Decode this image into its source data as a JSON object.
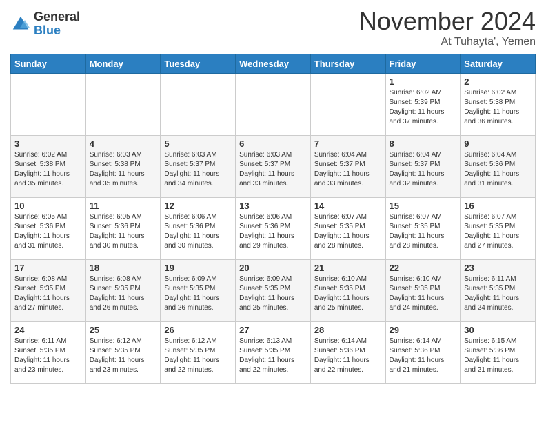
{
  "header": {
    "logo_general": "General",
    "logo_blue": "Blue",
    "month_title": "November 2024",
    "location": "At Tuhayta', Yemen"
  },
  "weekdays": [
    "Sunday",
    "Monday",
    "Tuesday",
    "Wednesday",
    "Thursday",
    "Friday",
    "Saturday"
  ],
  "weeks": [
    [
      {
        "day": "",
        "info": ""
      },
      {
        "day": "",
        "info": ""
      },
      {
        "day": "",
        "info": ""
      },
      {
        "day": "",
        "info": ""
      },
      {
        "day": "",
        "info": ""
      },
      {
        "day": "1",
        "info": "Sunrise: 6:02 AM\nSunset: 5:39 PM\nDaylight: 11 hours\nand 37 minutes."
      },
      {
        "day": "2",
        "info": "Sunrise: 6:02 AM\nSunset: 5:38 PM\nDaylight: 11 hours\nand 36 minutes."
      }
    ],
    [
      {
        "day": "3",
        "info": "Sunrise: 6:02 AM\nSunset: 5:38 PM\nDaylight: 11 hours\nand 35 minutes."
      },
      {
        "day": "4",
        "info": "Sunrise: 6:03 AM\nSunset: 5:38 PM\nDaylight: 11 hours\nand 35 minutes."
      },
      {
        "day": "5",
        "info": "Sunrise: 6:03 AM\nSunset: 5:37 PM\nDaylight: 11 hours\nand 34 minutes."
      },
      {
        "day": "6",
        "info": "Sunrise: 6:03 AM\nSunset: 5:37 PM\nDaylight: 11 hours\nand 33 minutes."
      },
      {
        "day": "7",
        "info": "Sunrise: 6:04 AM\nSunset: 5:37 PM\nDaylight: 11 hours\nand 33 minutes."
      },
      {
        "day": "8",
        "info": "Sunrise: 6:04 AM\nSunset: 5:37 PM\nDaylight: 11 hours\nand 32 minutes."
      },
      {
        "day": "9",
        "info": "Sunrise: 6:04 AM\nSunset: 5:36 PM\nDaylight: 11 hours\nand 31 minutes."
      }
    ],
    [
      {
        "day": "10",
        "info": "Sunrise: 6:05 AM\nSunset: 5:36 PM\nDaylight: 11 hours\nand 31 minutes."
      },
      {
        "day": "11",
        "info": "Sunrise: 6:05 AM\nSunset: 5:36 PM\nDaylight: 11 hours\nand 30 minutes."
      },
      {
        "day": "12",
        "info": "Sunrise: 6:06 AM\nSunset: 5:36 PM\nDaylight: 11 hours\nand 30 minutes."
      },
      {
        "day": "13",
        "info": "Sunrise: 6:06 AM\nSunset: 5:36 PM\nDaylight: 11 hours\nand 29 minutes."
      },
      {
        "day": "14",
        "info": "Sunrise: 6:07 AM\nSunset: 5:35 PM\nDaylight: 11 hours\nand 28 minutes."
      },
      {
        "day": "15",
        "info": "Sunrise: 6:07 AM\nSunset: 5:35 PM\nDaylight: 11 hours\nand 28 minutes."
      },
      {
        "day": "16",
        "info": "Sunrise: 6:07 AM\nSunset: 5:35 PM\nDaylight: 11 hours\nand 27 minutes."
      }
    ],
    [
      {
        "day": "17",
        "info": "Sunrise: 6:08 AM\nSunset: 5:35 PM\nDaylight: 11 hours\nand 27 minutes."
      },
      {
        "day": "18",
        "info": "Sunrise: 6:08 AM\nSunset: 5:35 PM\nDaylight: 11 hours\nand 26 minutes."
      },
      {
        "day": "19",
        "info": "Sunrise: 6:09 AM\nSunset: 5:35 PM\nDaylight: 11 hours\nand 26 minutes."
      },
      {
        "day": "20",
        "info": "Sunrise: 6:09 AM\nSunset: 5:35 PM\nDaylight: 11 hours\nand 25 minutes."
      },
      {
        "day": "21",
        "info": "Sunrise: 6:10 AM\nSunset: 5:35 PM\nDaylight: 11 hours\nand 25 minutes."
      },
      {
        "day": "22",
        "info": "Sunrise: 6:10 AM\nSunset: 5:35 PM\nDaylight: 11 hours\nand 24 minutes."
      },
      {
        "day": "23",
        "info": "Sunrise: 6:11 AM\nSunset: 5:35 PM\nDaylight: 11 hours\nand 24 minutes."
      }
    ],
    [
      {
        "day": "24",
        "info": "Sunrise: 6:11 AM\nSunset: 5:35 PM\nDaylight: 11 hours\nand 23 minutes."
      },
      {
        "day": "25",
        "info": "Sunrise: 6:12 AM\nSunset: 5:35 PM\nDaylight: 11 hours\nand 23 minutes."
      },
      {
        "day": "26",
        "info": "Sunrise: 6:12 AM\nSunset: 5:35 PM\nDaylight: 11 hours\nand 22 minutes."
      },
      {
        "day": "27",
        "info": "Sunrise: 6:13 AM\nSunset: 5:35 PM\nDaylight: 11 hours\nand 22 minutes."
      },
      {
        "day": "28",
        "info": "Sunrise: 6:14 AM\nSunset: 5:36 PM\nDaylight: 11 hours\nand 22 minutes."
      },
      {
        "day": "29",
        "info": "Sunrise: 6:14 AM\nSunset: 5:36 PM\nDaylight: 11 hours\nand 21 minutes."
      },
      {
        "day": "30",
        "info": "Sunrise: 6:15 AM\nSunset: 5:36 PM\nDaylight: 11 hours\nand 21 minutes."
      }
    ]
  ]
}
